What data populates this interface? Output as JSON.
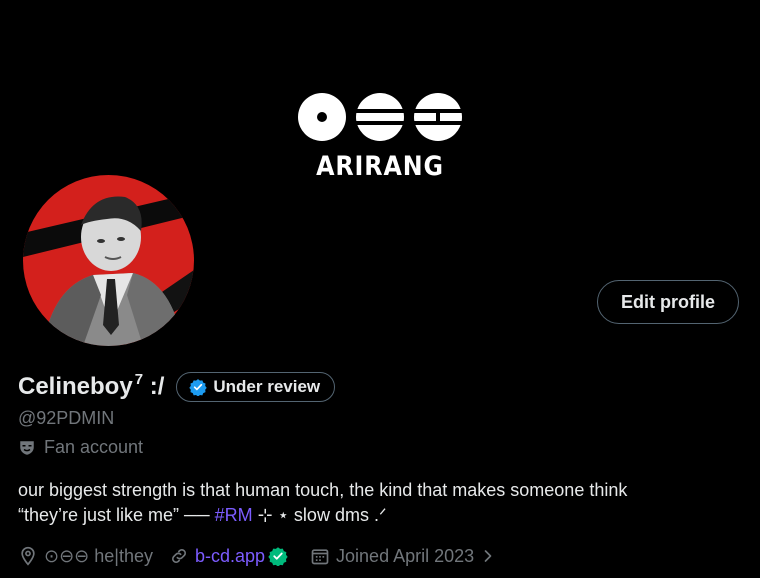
{
  "banner": {
    "logo_text": "ARIRANG",
    "logo_icon": "arirang-logo-icon"
  },
  "profile": {
    "display_name": "Celineboy",
    "name_suffix": ":/",
    "name_superscript": "7",
    "verification_badge": "Under review",
    "handle": "@92PDMIN",
    "category": "Fan account",
    "bio_line1": "our biggest strength is that human touch, the kind that makes someone think",
    "bio_line2_prefix": "“they’re just like me” ── ",
    "bio_hashtag": "#RM",
    "bio_line2_suffix": " ⊹ ⋆ slow dms .ᐟ",
    "location": "⊙⊖⊖ he|they",
    "website": "b-cd.app",
    "joined": "Joined April 2023"
  },
  "actions": {
    "edit_profile": "Edit profile"
  },
  "colors": {
    "background": "#000000",
    "text": "#e7e9ea",
    "muted": "#71767b",
    "link": "#7c5cff",
    "border": "#536471",
    "verified_blue": "#1d9bf0",
    "verified_green": "#00ba7c",
    "avatar_red": "#d3201c"
  }
}
